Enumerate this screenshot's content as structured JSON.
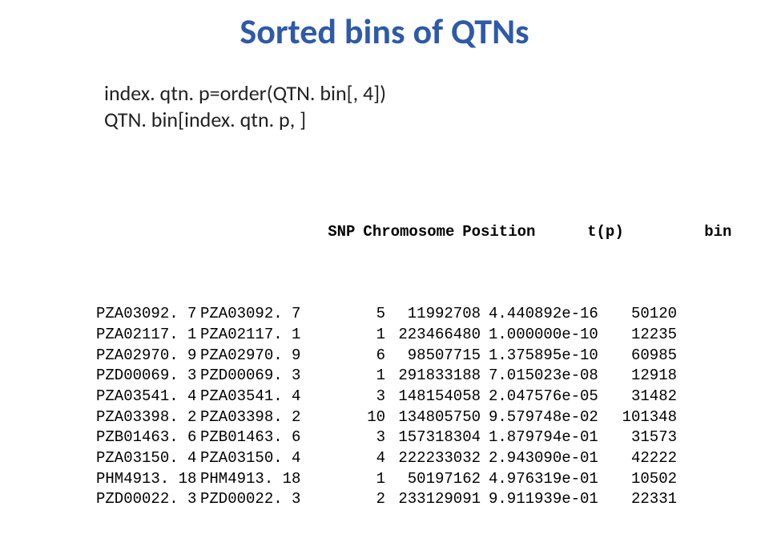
{
  "title": "Sorted bins of QTNs",
  "code": {
    "line1": "index. qtn. p=order(QTN. bin[, 4])",
    "line2": "QTN. bin[index. qtn. p, ]"
  },
  "table": {
    "headers": {
      "rowname": "",
      "snp": "SNP",
      "chromosome": "Chromosome",
      "position": "Position",
      "tp": "t(p)",
      "bin": "bin"
    },
    "rows": [
      {
        "rowname": "PZA03092. 7",
        "snp": "PZA03092. 7",
        "chromosome": 5,
        "position": 11992708,
        "tp": "4.440892e-16",
        "bin": 50120
      },
      {
        "rowname": "PZA02117. 1",
        "snp": "PZA02117. 1",
        "chromosome": 1,
        "position": 223466480,
        "tp": "1.000000e-10",
        "bin": 12235
      },
      {
        "rowname": "PZA02970. 9",
        "snp": "PZA02970. 9",
        "chromosome": 6,
        "position": 98507715,
        "tp": "1.375895e-10",
        "bin": 60985
      },
      {
        "rowname": "PZD00069. 3",
        "snp": "PZD00069. 3",
        "chromosome": 1,
        "position": 291833188,
        "tp": "7.015023e-08",
        "bin": 12918
      },
      {
        "rowname": "PZA03541. 4",
        "snp": "PZA03541. 4",
        "chromosome": 3,
        "position": 148154058,
        "tp": "2.047576e-05",
        "bin": 31482
      },
      {
        "rowname": "PZA03398. 2",
        "snp": "PZA03398. 2",
        "chromosome": 10,
        "position": 134805750,
        "tp": "9.579748e-02",
        "bin": 101348
      },
      {
        "rowname": "PZB01463. 6",
        "snp": "PZB01463. 6",
        "chromosome": 3,
        "position": 157318304,
        "tp": "1.879794e-01",
        "bin": 31573
      },
      {
        "rowname": "PZA03150. 4",
        "snp": "PZA03150. 4",
        "chromosome": 4,
        "position": 222233032,
        "tp": "2.943090e-01",
        "bin": 42222
      },
      {
        "rowname": "PHM4913. 18",
        "snp": "PHM4913. 18",
        "chromosome": 1,
        "position": 50197162,
        "tp": "4.976319e-01",
        "bin": 10502
      },
      {
        "rowname": "PZD00022. 3",
        "snp": "PZD00022. 3",
        "chromosome": 2,
        "position": 233129091,
        "tp": "9.911939e-01",
        "bin": 22331
      }
    ]
  },
  "chart_data": {
    "type": "table",
    "title": "Sorted bins of QTNs",
    "columns": [
      "rowname",
      "SNP",
      "Chromosome",
      "Position",
      "t(p)",
      "bin"
    ],
    "rows": [
      [
        "PZA03092. 7",
        "PZA03092. 7",
        5,
        11992708,
        4.440892e-16,
        50120
      ],
      [
        "PZA02117. 1",
        "PZA02117. 1",
        1,
        223466480,
        1e-10,
        12235
      ],
      [
        "PZA02970. 9",
        "PZA02970. 9",
        6,
        98507715,
        1.375895e-10,
        60985
      ],
      [
        "PZD00069. 3",
        "PZD00069. 3",
        1,
        291833188,
        7.015023e-08,
        12918
      ],
      [
        "PZA03541. 4",
        "PZA03541. 4",
        3,
        148154058,
        2.047576e-05,
        31482
      ],
      [
        "PZA03398. 2",
        "PZA03398. 2",
        10,
        134805750,
        0.09579748,
        101348
      ],
      [
        "PZB01463. 6",
        "PZB01463. 6",
        3,
        157318304,
        0.1879794,
        31573
      ],
      [
        "PZA03150. 4",
        "PZA03150. 4",
        4,
        222233032,
        0.294309,
        42222
      ],
      [
        "PHM4913. 18",
        "PHM4913. 18",
        1,
        50197162,
        0.4976319,
        10502
      ],
      [
        "PZD00022. 3",
        "PZD00022. 3",
        2,
        233129091,
        0.9911939,
        22331
      ]
    ]
  }
}
